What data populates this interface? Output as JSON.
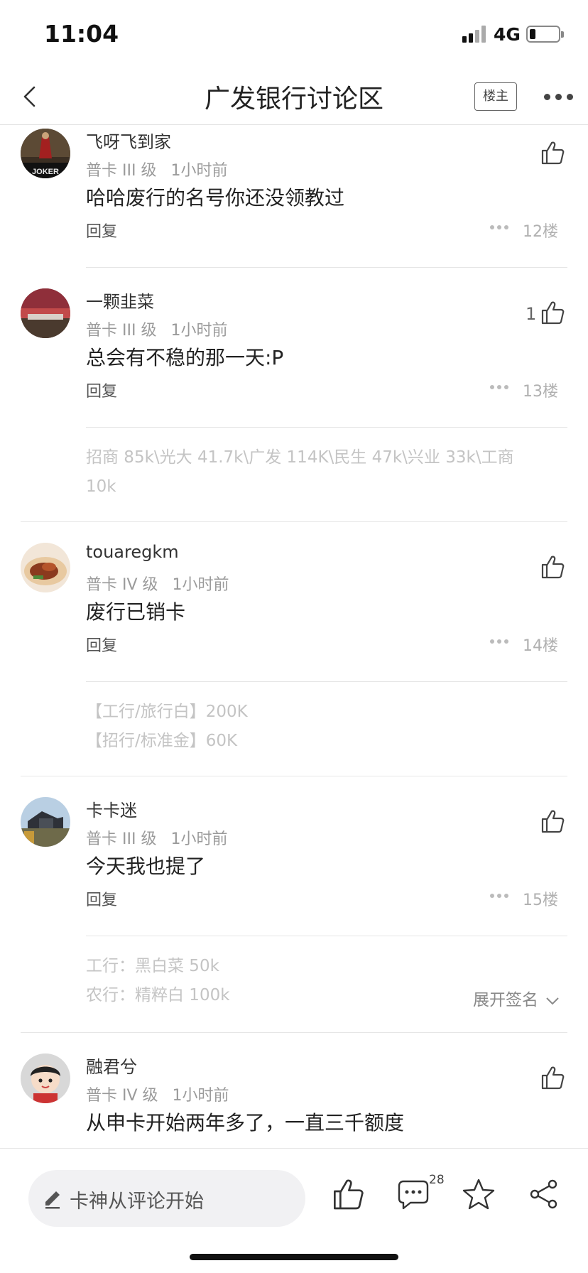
{
  "status_bar": {
    "time": "11:04",
    "network": "4G",
    "battery_level": 0.2
  },
  "nav": {
    "title": "广发银行讨论区",
    "owner_label": "楼主",
    "back_icon": "chevron-left-icon",
    "more_icon": "more-dots-icon"
  },
  "posts": [
    {
      "username": "飞呀飞到家",
      "level": "普卡 III 级",
      "time": "1小时前",
      "content": "哈哈废行的名号你还没领教过",
      "reply_label": "回复",
      "floor": "12楼",
      "likes": ""
    },
    {
      "username": "一颗韭菜",
      "level": "普卡 III 级",
      "time": "1小时前",
      "content": "总会有不稳的那一天:P",
      "reply_label": "回复",
      "floor": "13楼",
      "likes": "1",
      "signature": [
        "招商 85k\\光大 41.7k\\广发 114K\\民生 47k\\兴业 33k\\工商",
        "10k"
      ]
    },
    {
      "username": "touaregkm",
      "level": "普卡 IV 级",
      "time": "1小时前",
      "content": "废行已销卡",
      "reply_label": "回复",
      "floor": "14楼",
      "likes": "",
      "signature": [
        "【工行/旅行白】200K",
        "【招行/标准金】60K"
      ]
    },
    {
      "username": "卡卡迷",
      "level": "普卡 III 级",
      "time": "1小时前",
      "content": "今天我也提了",
      "reply_label": "回复",
      "floor": "15楼",
      "likes": "",
      "signature": [
        "工行：黑白菜 50k",
        "农行：精粹白 100k"
      ],
      "expand_label": "展开签名"
    },
    {
      "username": "融君兮",
      "level": "普卡 IV 级",
      "time": "1小时前",
      "content": "从申卡开始两年多了，一直三千额度"
    }
  ],
  "bottom_bar": {
    "comment_placeholder": "卡神从评论开始",
    "comment_count": "28",
    "icons": [
      "pencil-icon",
      "thumb-up-icon",
      "comment-icon",
      "star-icon",
      "share-icon"
    ]
  }
}
